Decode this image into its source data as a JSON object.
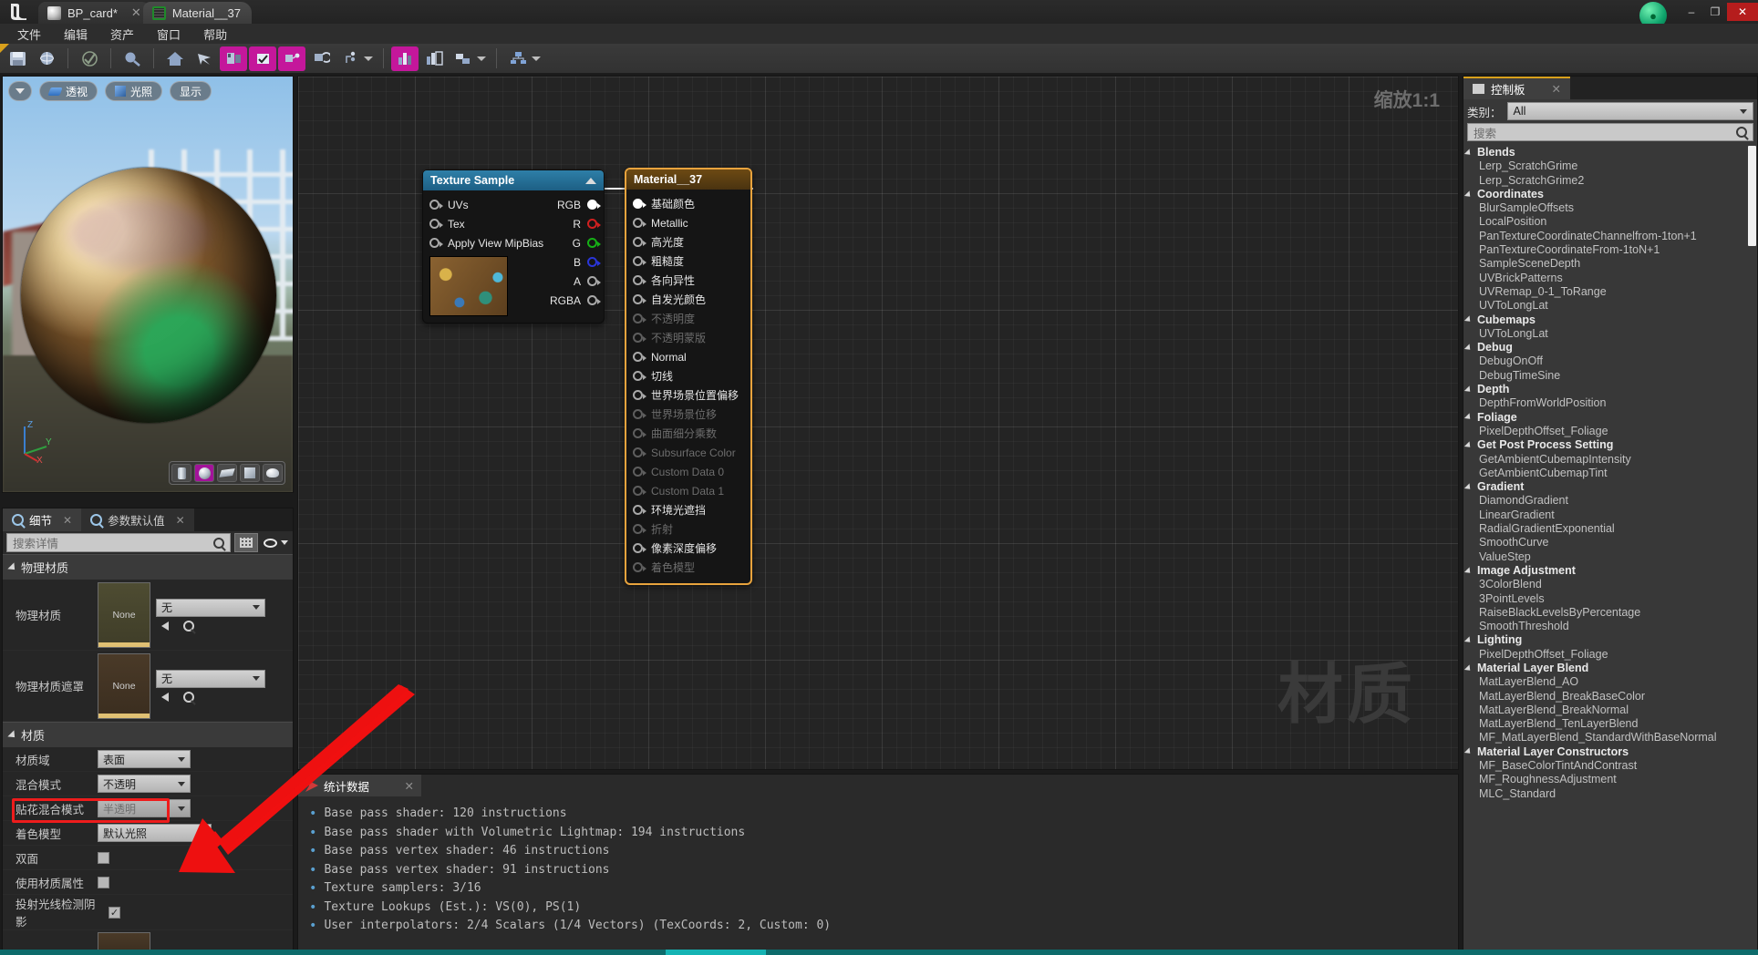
{
  "titlebar": {
    "tabs": [
      {
        "label": "BP_card*",
        "icon": "sphere-icon",
        "active": false
      },
      {
        "label": "Material__37",
        "icon": "material-icon",
        "active": true
      }
    ],
    "window_buttons": {
      "minimize": "–",
      "maximize": "❐",
      "close": "✕"
    }
  },
  "menubar": {
    "items": [
      "文件",
      "编辑",
      "资产",
      "窗口",
      "帮助"
    ]
  },
  "toolbar": {
    "buttons": [
      "save-icon",
      "browse-icon",
      "apply-icon",
      "search-icon",
      "home-icon",
      "clean-icon",
      "preview-node-icon",
      "live-preview-icon",
      "live-nodes-icon",
      "live-update-icon",
      "hierarchy-icon",
      "stats-icon",
      "platform-stats-icon",
      "mobile-stats-icon"
    ]
  },
  "viewport": {
    "buttons": [
      "透视",
      "光照",
      "显示"
    ],
    "shapes": [
      "cylinder-icon",
      "sphere-icon",
      "plane-icon",
      "cube-icon",
      "teapot-icon"
    ],
    "selected_shape_index": 1,
    "axis": {
      "z": "Z",
      "y": "Y",
      "x": "X"
    }
  },
  "details": {
    "tabs": [
      {
        "label": "细节",
        "active": true
      },
      {
        "label": "参数默认值",
        "active": false
      }
    ],
    "search_placeholder": "搜索详情",
    "sections": [
      {
        "title": "物理材质",
        "rows": [
          {
            "label": "物理材质",
            "type": "asset",
            "thumb_text": "None",
            "value": "无"
          },
          {
            "label": "物理材质遮罩",
            "type": "asset",
            "thumb_text": "None",
            "value": "无"
          }
        ]
      },
      {
        "title": "材质",
        "rows": [
          {
            "label": "材质域",
            "type": "combo",
            "value": "表面",
            "dim": false
          },
          {
            "label": "混合模式",
            "type": "combo",
            "value": "不透明",
            "dim": false
          },
          {
            "label": "贴花混合模式",
            "type": "combo",
            "value": "半透明",
            "dim": true
          },
          {
            "label": "着色模型",
            "type": "combo",
            "value": "默认光照",
            "dim": false
          },
          {
            "label": "双面",
            "type": "check",
            "checked": false
          },
          {
            "label": "使用材质属性",
            "type": "check",
            "checked": false
          },
          {
            "label": "投射光线检测阴影",
            "type": "check",
            "checked": true
          }
        ]
      }
    ],
    "highlight_color": "#ee1c1c"
  },
  "graph": {
    "zoom_label": "缩放1:1",
    "watermark": "材质",
    "nodes": [
      {
        "id": "texture-sample",
        "title": "Texture Sample",
        "inputs": [
          "UVs",
          "Tex",
          "Apply View MipBias"
        ],
        "outputs": [
          {
            "label": "RGB",
            "color": "white",
            "connected": true
          },
          {
            "label": "R",
            "color": "red",
            "connected": false
          },
          {
            "label": "G",
            "color": "green",
            "connected": false
          },
          {
            "label": "B",
            "color": "blue",
            "connected": false
          },
          {
            "label": "A",
            "color": "grey",
            "connected": false
          },
          {
            "label": "RGBA",
            "color": "grey",
            "connected": false
          }
        ]
      },
      {
        "id": "material-output",
        "title": "Material__37",
        "pins": [
          {
            "label": "基础颜色",
            "enabled": true,
            "connected": true
          },
          {
            "label": "Metallic",
            "enabled": true,
            "connected": false
          },
          {
            "label": "高光度",
            "enabled": true,
            "connected": false
          },
          {
            "label": "粗糙度",
            "enabled": true,
            "connected": false
          },
          {
            "label": "各向异性",
            "enabled": true,
            "connected": false
          },
          {
            "label": "自发光颜色",
            "enabled": true,
            "connected": false
          },
          {
            "label": "不透明度",
            "enabled": false,
            "connected": false
          },
          {
            "label": "不透明蒙版",
            "enabled": false,
            "connected": false
          },
          {
            "label": "Normal",
            "enabled": true,
            "connected": false
          },
          {
            "label": "切线",
            "enabled": true,
            "connected": false
          },
          {
            "label": "世界场景位置偏移",
            "enabled": true,
            "connected": false
          },
          {
            "label": "世界场景位移",
            "enabled": false,
            "connected": false
          },
          {
            "label": "曲面细分乘数",
            "enabled": false,
            "connected": false
          },
          {
            "label": "Subsurface Color",
            "enabled": false,
            "connected": false
          },
          {
            "label": "Custom Data 0",
            "enabled": false,
            "connected": false
          },
          {
            "label": "Custom Data 1",
            "enabled": false,
            "connected": false
          },
          {
            "label": "环境光遮挡",
            "enabled": true,
            "connected": false
          },
          {
            "label": "折射",
            "enabled": false,
            "connected": false
          },
          {
            "label": "像素深度偏移",
            "enabled": true,
            "connected": false
          },
          {
            "label": "着色模型",
            "enabled": false,
            "connected": false
          }
        ]
      }
    ]
  },
  "stats": {
    "tab_label": "统计数据",
    "lines": [
      "Base pass shader: 120 instructions",
      "Base pass shader with Volumetric Lightmap: 194 instructions",
      "Base pass vertex shader: 46 instructions",
      "Base pass vertex shader: 91 instructions",
      "Texture samplers: 3/16",
      "Texture Lookups (Est.): VS(0), PS(1)",
      "User interpolators: 2/4 Scalars (1/4 Vectors) (TexCoords: 2, Custom: 0)"
    ]
  },
  "palette": {
    "tab_label": "控制板",
    "category_label": "类别：",
    "category_value": "All",
    "search_placeholder": "搜索",
    "groups": [
      {
        "name": "Blends",
        "items": [
          "Lerp_ScratchGrime",
          "Lerp_ScratchGrime2"
        ]
      },
      {
        "name": "Coordinates",
        "items": [
          "BlurSampleOffsets",
          "LocalPosition",
          "PanTextureCoordinateChannelfrom-1ton+1",
          "PanTextureCoordinateFrom-1toN+1",
          "SampleSceneDepth",
          "UVBrickPatterns",
          "UVRemap_0-1_ToRange",
          "UVToLongLat"
        ]
      },
      {
        "name": "Cubemaps",
        "items": [
          "UVToLongLat"
        ]
      },
      {
        "name": "Debug",
        "items": [
          "DebugOnOff",
          "DebugTimeSine"
        ]
      },
      {
        "name": "Depth",
        "items": [
          "DepthFromWorldPosition"
        ]
      },
      {
        "name": "Foliage",
        "items": [
          "PixelDepthOffset_Foliage"
        ]
      },
      {
        "name": "Get Post Process Setting",
        "items": [
          "GetAmbientCubemapIntensity",
          "GetAmbientCubemapTint"
        ]
      },
      {
        "name": "Gradient",
        "items": [
          "DiamondGradient",
          "LinearGradient",
          "RadialGradientExponential",
          "SmoothCurve",
          "ValueStep"
        ]
      },
      {
        "name": "Image Adjustment",
        "items": [
          "3ColorBlend",
          "3PointLevels",
          "RaiseBlackLevelsByPercentage",
          "SmoothThreshold"
        ]
      },
      {
        "name": "Lighting",
        "items": [
          "PixelDepthOffset_Foliage"
        ]
      },
      {
        "name": "Material Layer Blend",
        "items": [
          "MatLayerBlend_AO",
          "MatLayerBlend_BreakBaseColor",
          "MatLayerBlend_BreakNormal",
          "MatLayerBlend_TenLayerBlend",
          "MF_MatLayerBlend_StandardWithBaseNormal"
        ]
      },
      {
        "name": "Material Layer Constructors",
        "items": [
          "MF_BaseColorTintAndContrast",
          "MF_RoughnessAdjustment",
          "MLC_Standard"
        ]
      }
    ]
  }
}
